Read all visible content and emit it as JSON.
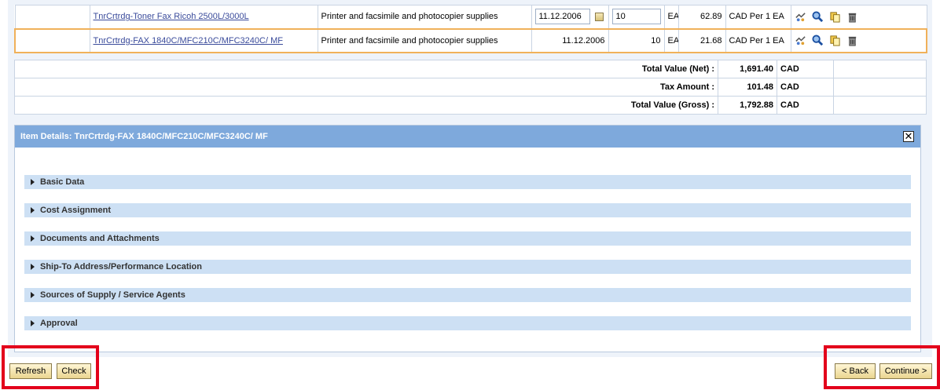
{
  "items": [
    {
      "name": "TnrCrtrdg-Toner Fax Ricoh 2500L/3000L",
      "category": "Printer and facsimile and photocopier supplies",
      "delivery_date": "11.12.2006",
      "quantity": "10",
      "unit": "EA",
      "price": "62.89",
      "currency_per": "CAD Per 1 EA"
    },
    {
      "name": "TnrCrtrdg-FAX 1840C/MFC210C/MFC3240C/ MF",
      "category": "Printer and facsimile and photocopier supplies",
      "delivery_date": "11.12.2006",
      "quantity": "10",
      "unit": "EA",
      "price": "21.68",
      "currency_per": "CAD Per 1 EA"
    }
  ],
  "totals": [
    {
      "label": "Total Value (Net)  :",
      "value": "1,691.40",
      "currency": "CAD"
    },
    {
      "label": "Tax Amount  :",
      "value": "101.48",
      "currency": "CAD"
    },
    {
      "label": "Total Value (Gross)  :",
      "value": "1,792.88",
      "currency": "CAD"
    }
  ],
  "details": {
    "title": "Item Details: TnrCrtrdg-FAX 1840C/MFC210C/MFC3240C/ MF",
    "close": "✕",
    "sections": [
      "Basic Data",
      "Cost Assignment",
      "Documents and Attachments",
      "Ship-To Address/Performance Location",
      "Sources of Supply / Service Agents",
      "Approval"
    ]
  },
  "buttons": {
    "refresh": "Refresh",
    "check": "Check",
    "back": "< Back",
    "continue": "Continue >"
  },
  "colors": {
    "highlight_box": "#e3001b",
    "header_bg": "#7ea9dc",
    "section_bg": "#cde0f4",
    "selected_row": "#f0b15a"
  },
  "icons": [
    "distribute-icon",
    "search-icon",
    "copy-icon",
    "delete-icon"
  ]
}
